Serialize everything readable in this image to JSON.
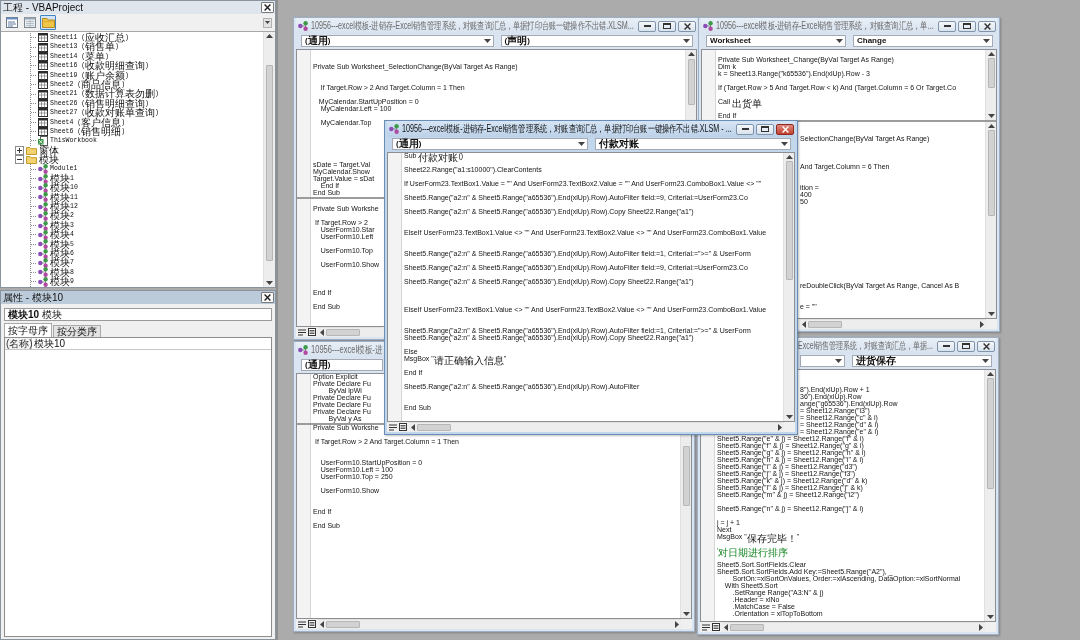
{
  "project_panel": {
    "title": "工程 - VBAProject",
    "toolbar": [
      {
        "kind": "code",
        "selected": false
      },
      {
        "kind": "object",
        "selected": false
      },
      {
        "kind": "folders",
        "selected": true
      }
    ],
    "tree": [
      {
        "children": [
          {
            "kind": "sheet",
            "label": "Sheet11 (应收汇总)"
          },
          {
            "kind": "sheet",
            "label": "Sheet13 (销售单)"
          },
          {
            "kind": "sheet",
            "label": "Sheet14 (菜单)"
          },
          {
            "kind": "sheet",
            "label": "Sheet16 (收款明细查询)"
          },
          {
            "kind": "sheet",
            "label": "Sheet19 (账户余额)"
          },
          {
            "kind": "sheet",
            "label": "Sheet2 (商品信息)"
          },
          {
            "kind": "sheet",
            "label": "Sheet21 (数据计算表勿删)"
          },
          {
            "kind": "sheet",
            "label": "Sheet26 (销售明细查询)"
          },
          {
            "kind": "sheet",
            "label": "Sheet27 (收款对账单查询)"
          },
          {
            "kind": "sheet",
            "label": "Sheet4 (客户信息)"
          },
          {
            "kind": "sheet",
            "label": "Sheet6 (销售明细)"
          },
          {
            "kind": "workbook",
            "label": "ThisWorkbook"
          }
        ]
      },
      {
        "kind": "folder",
        "label": "窗体",
        "expanded": false
      },
      {
        "kind": "folder",
        "label": "模块",
        "expanded": true,
        "children": [
          {
            "kind": "module",
            "label": "Module1"
          },
          {
            "kind": "module",
            "label": "模块1"
          },
          {
            "kind": "module",
            "label": "模块10"
          },
          {
            "kind": "module",
            "label": "模块11"
          },
          {
            "kind": "module",
            "label": "模块12"
          },
          {
            "kind": "module",
            "label": "模块2"
          },
          {
            "kind": "module",
            "label": "模块3"
          },
          {
            "kind": "module",
            "label": "模块4"
          },
          {
            "kind": "module",
            "label": "模块5"
          },
          {
            "kind": "module",
            "label": "模块6"
          },
          {
            "kind": "module",
            "label": "模块7"
          },
          {
            "kind": "module",
            "label": "模块8"
          },
          {
            "kind": "module",
            "label": "模块9"
          }
        ]
      }
    ]
  },
  "properties_panel": {
    "title": "属性 - 模块10",
    "object": "**模块10** 模块",
    "tabs": [
      {
        "label": "按字母序",
        "selected": true
      },
      {
        "label": "按分类序",
        "selected": false
      }
    ],
    "rows": [
      {
        "name": "(名称)",
        "value": "模块10"
      }
    ]
  },
  "windows": [
    {
      "title": "10956---excel模板-进销存-Excel销售管理系统，对账查询汇总，单据打印台账一键操作不出错.XLSM...",
      "active": false,
      "dropdowns": [
        {
          "value": "(通用)"
        },
        {
          "value": "(声明)"
        }
      ],
      "panes": [
        {
          "lines": [
            {
              "kind": "blank"
            },
            {
              "kind": "blank"
            },
            {
              "kind": "code",
              "text": "Private Sub Worksheet_SelectionChange(ByVal Target As Range)"
            },
            {
              "kind": "blank"
            },
            {
              "kind": "blank"
            },
            {
              "kind": "code",
              "text": "    If Target.Row > 2 And Target.Column = 1 Then"
            },
            {
              "kind": "blank"
            },
            {
              "kind": "code",
              "text": "   MyCalendar.StartUpPosition = 0"
            },
            {
              "kind": "code",
              "text": "    MyCalendar.Left = 100"
            },
            {
              "kind": "blank"
            },
            {
              "kind": "code",
              "text": "    MyCalendar.Top"
            },
            {
              "kind": "blank"
            },
            {
              "kind": "blank"
            },
            {
              "kind": "blank"
            },
            {
              "kind": "blank"
            },
            {
              "kind": "blank"
            },
            {
              "kind": "code",
              "text": "sDate = Target.Val"
            },
            {
              "kind": "code",
              "text": "MyCalendar.Show"
            },
            {
              "kind": "code",
              "text": "Target.Value = sDat"
            },
            {
              "kind": "code",
              "text": "    End If"
            },
            {
              "kind": "code",
              "text": "End Sub"
            }
          ]
        },
        {
          "lines": [
            {
              "kind": "blank"
            },
            {
              "kind": "code",
              "text": "Private Sub Workshe"
            },
            {
              "kind": "blank"
            },
            {
              "kind": "code",
              "text": " If Target.Row > 2"
            },
            {
              "kind": "code",
              "text": "    UserForm10.Star"
            },
            {
              "kind": "code",
              "text": "    UserForm10.Left"
            },
            {
              "kind": "blank"
            },
            {
              "kind": "code",
              "text": "    UserForm10.Top"
            },
            {
              "kind": "blank"
            },
            {
              "kind": "code",
              "text": "    UserForm10.Show"
            },
            {
              "kind": "blank"
            },
            {
              "kind": "blank"
            },
            {
              "kind": "blank"
            },
            {
              "kind": "code",
              "text": "End If"
            },
            {
              "kind": "blank"
            },
            {
              "kind": "code",
              "text": "End Sub"
            }
          ]
        }
      ]
    },
    {
      "title": "10956---excel模板-进销存-Excel销售管理系统，对账查询汇总，单...",
      "active": false,
      "dropdowns": [
        {
          "value": "Worksheet"
        },
        {
          "value": "Change"
        }
      ],
      "panes": [
        {
          "lines": [
            {
              "kind": "blank"
            },
            {
              "kind": "code",
              "text": "Private Sub Worksheet_Change(ByVal Target As Range)"
            },
            {
              "kind": "code",
              "text": "Dim k"
            },
            {
              "kind": "code",
              "text": "k = Sheet13.Range(\"k65536\").End(xlUp).Row - 3"
            },
            {
              "kind": "blank"
            },
            {
              "kind": "code",
              "text": "If (Target.Row > 5 And Target.Row < k) And (Target.Column = 6 Or Target.Co"
            },
            {
              "kind": "blank"
            },
            {
              "kind": "code",
              "text": "Call 出货单"
            },
            {
              "kind": "blank"
            },
            {
              "kind": "code",
              "text": "End If"
            }
          ]
        },
        {
          "lines": [
            {
              "kind": "blank"
            },
            {
              "kind": "blank"
            },
            {
              "kind": "tail",
              "text": "SelectionChange(ByVal Target As Range)"
            },
            {
              "kind": "blank"
            },
            {
              "kind": "blank"
            },
            {
              "kind": "blank"
            },
            {
              "kind": "tail",
              "text": "And Target.Column = 6 Then"
            },
            {
              "kind": "blank"
            },
            {
              "kind": "blank"
            },
            {
              "kind": "tail",
              "text": "ition ="
            },
            {
              "kind": "tail",
              "text": "400"
            },
            {
              "kind": "tail",
              "text": "50"
            },
            {
              "kind": "blank"
            },
            {
              "kind": "blank"
            },
            {
              "kind": "blank"
            },
            {
              "kind": "blank"
            },
            {
              "kind": "blank"
            },
            {
              "kind": "blank"
            },
            {
              "kind": "blank"
            },
            {
              "kind": "blank"
            },
            {
              "kind": "blank"
            },
            {
              "kind": "blank"
            },
            {
              "kind": "blank"
            },
            {
              "kind": "tail",
              "text": "reDoubleClick(ByVal Target As Range, Cancel As B"
            },
            {
              "kind": "blank"
            },
            {
              "kind": "blank"
            },
            {
              "kind": "tail",
              "text": "e = \"\""
            }
          ]
        }
      ]
    },
    {
      "title": "10956---excel模板-进销存-Excel销售管理系统，对账查询汇总，单据打印台账一键操作不出错.XLSM - ...",
      "active": true,
      "dropdowns": [
        {
          "value": "(通用)"
        },
        {
          "value": "付款对账"
        }
      ],
      "panes": [
        {
          "lines": [
            {
              "kind": "code",
              "text": "Sub 付款对账()"
            },
            {
              "kind": "blank"
            },
            {
              "kind": "code",
              "text": "Sheet22.Range(\"a1:s10000\").ClearContents"
            },
            {
              "kind": "blank"
            },
            {
              "kind": "code",
              "text": "If UserForm23.TextBox1.Value = \"\" And UserForm23.TextBox2.Value = \"\" And UserForm23.ComboBox1.Value <> \"\""
            },
            {
              "kind": "blank"
            },
            {
              "kind": "code",
              "text": "Sheet5.Range(\"a2:n\" & Sheet5.Range(\"a65536\").End(xlUp).Row).AutoFilter field:=9, Criterial:=UserForm23.Co"
            },
            {
              "kind": "blank"
            },
            {
              "kind": "code",
              "text": "Sheet5.Range(\"a2:n\" & Sheet5.Range(\"a65536\").End(xlUp).Row).Copy Sheet22.Range(\"a1\")"
            },
            {
              "kind": "blank"
            },
            {
              "kind": "blank"
            },
            {
              "kind": "code",
              "text": "ElseIf UserForm23.TextBox1.Value <> \"\" And UserForm23.TextBox2.Value <> \"\" And UserForm23.ComboBox1.Value"
            },
            {
              "kind": "blank"
            },
            {
              "kind": "blank"
            },
            {
              "kind": "code",
              "text": "Sheet5.Range(\"a2:n\" & Sheet5.Range(\"a65536\").End(xlUp).Row).AutoFilter field:=1, Criterial:=\">=\" & UserForm"
            },
            {
              "kind": "blank"
            },
            {
              "kind": "code",
              "text": "Sheet5.Range(\"a2:n\" & Sheet5.Range(\"a65536\").End(xlUp).Row).AutoFilter field:=9, Criterial:=UserForm23.Co"
            },
            {
              "kind": "blank"
            },
            {
              "kind": "code",
              "text": "Sheet5.Range(\"a2:n\" & Sheet5.Range(\"a65536\").End(xlUp).Row).Copy Sheet22.Range(\"a1\")"
            },
            {
              "kind": "blank"
            },
            {
              "kind": "blank"
            },
            {
              "kind": "blank"
            },
            {
              "kind": "code",
              "text": "ElseIf UserForm23.TextBox1.Value <> \"\" And UserForm23.TextBox2.Value <> \"\" And UserForm23.ComboBox1.Value"
            },
            {
              "kind": "blank"
            },
            {
              "kind": "blank"
            },
            {
              "kind": "code",
              "text": "Sheet5.Range(\"a2:n\" & Sheet5.Range(\"a65536\").End(xlUp).Row).AutoFilter field:=1, Criterial:=\">=\" & UserForm"
            },
            {
              "kind": "code",
              "text": "Sheet5.Range(\"a2:n\" & Sheet5.Range(\"a65536\").End(xlUp).Row).Copy Sheet22.Range(\"a1\")"
            },
            {
              "kind": "blank"
            },
            {
              "kind": "code",
              "text": "Else"
            },
            {
              "kind": "code",
              "text": "MsgBox \"请正确输入信息\""
            },
            {
              "kind": "blank"
            },
            {
              "kind": "code",
              "text": "End If"
            },
            {
              "kind": "blank"
            },
            {
              "kind": "code",
              "text": "Sheet5.Range(\"a2:n\" & Sheet5.Range(\"a65536\").End(xlUp).Row).AutoFilter"
            },
            {
              "kind": "blank"
            },
            {
              "kind": "blank"
            },
            {
              "kind": "code",
              "text": "End Sub"
            }
          ]
        }
      ]
    },
    {
      "title": "10956---excel模板-进",
      "active": false,
      "dropdowns": [
        {
          "value": "(通用)"
        }
      ],
      "panes": [
        {
          "lines": [
            {
              "kind": "code",
              "text": "Option Explicit"
            },
            {
              "kind": "code",
              "text": "Private Declare Fu"
            },
            {
              "kind": "code",
              "text": "        ByVal lpWi"
            },
            {
              "kind": "code",
              "text": "Private Declare Fu"
            },
            {
              "kind": "code",
              "text": "Private Declare Fu"
            },
            {
              "kind": "code",
              "text": "Private Declare Fu"
            },
            {
              "kind": "code",
              "text": "        ByVal y As"
            }
          ]
        },
        {
          "lines": [
            {
              "kind": "code",
              "text": "Private Sub Workshe"
            },
            {
              "kind": "blank"
            },
            {
              "kind": "code",
              "text": " If Target.Row > 2 And Target.Column = 1 Then"
            },
            {
              "kind": "blank"
            },
            {
              "kind": "blank"
            },
            {
              "kind": "code",
              "text": "    UserForm10.StartUpPosition = 0"
            },
            {
              "kind": "code",
              "text": "    UserForm10.Left = 100"
            },
            {
              "kind": "code",
              "text": "    UserForm10.Top = 250"
            },
            {
              "kind": "blank"
            },
            {
              "kind": "code",
              "text": "    UserForm10.Show"
            },
            {
              "kind": "blank"
            },
            {
              "kind": "blank"
            },
            {
              "kind": "code",
              "text": "End If"
            },
            {
              "kind": "blank"
            },
            {
              "kind": "code",
              "text": "End Sub"
            }
          ]
        }
      ]
    },
    {
      "title": "Excel销售管理系统，对账查询汇总，单据...",
      "active": false,
      "dropdowns": [
        {
          "value": "进货保存"
        }
      ],
      "panes": [
        {
          "lines": [
            {
              "kind": "blank"
            },
            {
              "kind": "blank"
            },
            {
              "kind": "tail",
              "text": "8\").End(xlUp).Row + 1"
            },
            {
              "kind": "tail",
              "text": "36\").End(xlUp).Row"
            },
            {
              "kind": "tail",
              "text": "ange(\"g65536\").End(xlUp).Row"
            },
            {
              "kind": "tail",
              "text": "= Sheet12.Range(\"i3\")"
            },
            {
              "kind": "tail",
              "text": "= Sheet12.Range(\"c\" & i)"
            },
            {
              "kind": "tail",
              "text": "= Sheet12.Range(\"d\" & i)"
            },
            {
              "kind": "tail",
              "text": "= Sheet12.Range(\"e\" & i)"
            },
            {
              "kind": "code",
              "text": "Sheet5.Range(\"e\" & j) = Sheet12.Range(\"f\" & i)"
            },
            {
              "kind": "code",
              "text": "Sheet5.Range(\"f\" & j) = Sheet12.Range(\"g\" & i)"
            },
            {
              "kind": "code",
              "text": "Sheet5.Range(\"g\" & j) = Sheet12.Range(\"h\" & i)"
            },
            {
              "kind": "code",
              "text": "Sheet5.Range(\"h\" & j) = Sheet12.Range(\"i\" & i)"
            },
            {
              "kind": "code",
              "text": "Sheet5.Range(\"i\" & j) = Sheet12.Range(\"d3\")"
            },
            {
              "kind": "code",
              "text": "Sheet5.Range(\"j\" & j) = Sheet12.Range(\"f3\")"
            },
            {
              "kind": "code",
              "text": "Sheet5.Range(\"k\" & j) = Sheet12.Range(\"d\" & k)"
            },
            {
              "kind": "code",
              "text": "Sheet5.Range(\"l\" & j) = Sheet12.Range(\"j\" & k)"
            },
            {
              "kind": "code",
              "text": "Sheet5.Range(\"m\" & j) = Sheet12.Range(\"i2\")"
            },
            {
              "kind": "blank"
            },
            {
              "kind": "code",
              "text": "Sheet5.Range(\"n\" & j) = Sheet12.Range(\"j\" & i)"
            },
            {
              "kind": "blank"
            },
            {
              "kind": "code",
              "text": "j = j + 1"
            },
            {
              "kind": "code",
              "text": "Next"
            },
            {
              "kind": "code",
              "text": "MsgBox \"保存完毕！\""
            },
            {
              "kind": "blank"
            },
            {
              "kind": "comment",
              "text": "'对日期进行排序"
            },
            {
              "kind": "blank"
            },
            {
              "kind": "code",
              "text": "Sheet5.Sort.SortFields.Clear"
            },
            {
              "kind": "code",
              "text": "Sheet5.Sort.SortFields.Add Key:=Sheet5.Range(\"A2\"), _"
            },
            {
              "kind": "code",
              "text": "        SortOn:=xlSortOnValues, Order:=xlAscending, DataOption:=xlSortNormal"
            },
            {
              "kind": "code",
              "text": "    With Sheet5.Sort"
            },
            {
              "kind": "code",
              "text": "        .SetRange Range(\"A3:N\" & j)"
            },
            {
              "kind": "code",
              "text": "        .Header = xlNo"
            },
            {
              "kind": "code",
              "text": "        .MatchCase = False"
            },
            {
              "kind": "code",
              "text": "        .Orientation = xlTopToBottom"
            }
          ]
        }
      ]
    }
  ]
}
